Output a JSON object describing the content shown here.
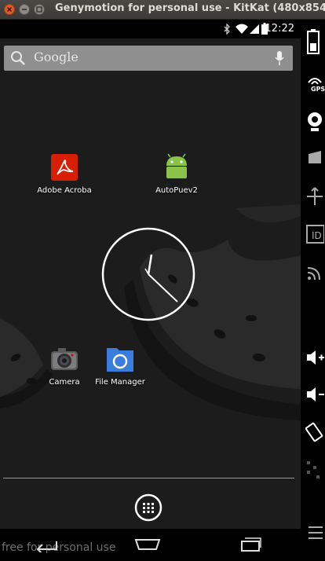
{
  "window": {
    "title": "Genymotion for personal use - KitKat (480x854,"
  },
  "statusbar": {
    "time": "12:22",
    "icons": [
      "bluetooth-icon",
      "wifi-icon",
      "signal-icon",
      "battery-icon"
    ]
  },
  "search": {
    "placeholder": "Google",
    "icon": "search-icon",
    "voice_icon": "mic-icon"
  },
  "apps": [
    {
      "label": "Adobe Acroba",
      "icon": "adobe-acrobat-icon"
    },
    {
      "label": "AutoPuev2",
      "icon": "android-icon"
    },
    {
      "label": "Camera",
      "icon": "camera-icon"
    },
    {
      "label": "File Manager",
      "icon": "file-manager-icon"
    }
  ],
  "widget": {
    "type": "analog-clock"
  },
  "dock": {
    "app_drawer_icon": "app-drawer-icon"
  },
  "navbar": {
    "icons": [
      "back-icon",
      "home-icon",
      "recents-icon"
    ]
  },
  "watermark": {
    "text": "free for personal use"
  },
  "sidebar": {
    "gps_label": "GPS",
    "items": [
      "battery-icon",
      "gps-icon",
      "webcam-icon",
      "remote-control-icon",
      "rotate-icon",
      "id-icon",
      "cast-icon",
      "volume-up-icon",
      "volume-down-icon",
      "rotate-screen-icon",
      "pixel-perfect-icon",
      "menu-icon"
    ]
  },
  "colors": {
    "titlebar": "#3b3a36",
    "close_button": "#e05a2b",
    "search_bar": "#8f8f8f",
    "acrobat_red": "#d81e05",
    "android_green": "#8bc34a",
    "folder_blue": "#3b7ddd"
  }
}
